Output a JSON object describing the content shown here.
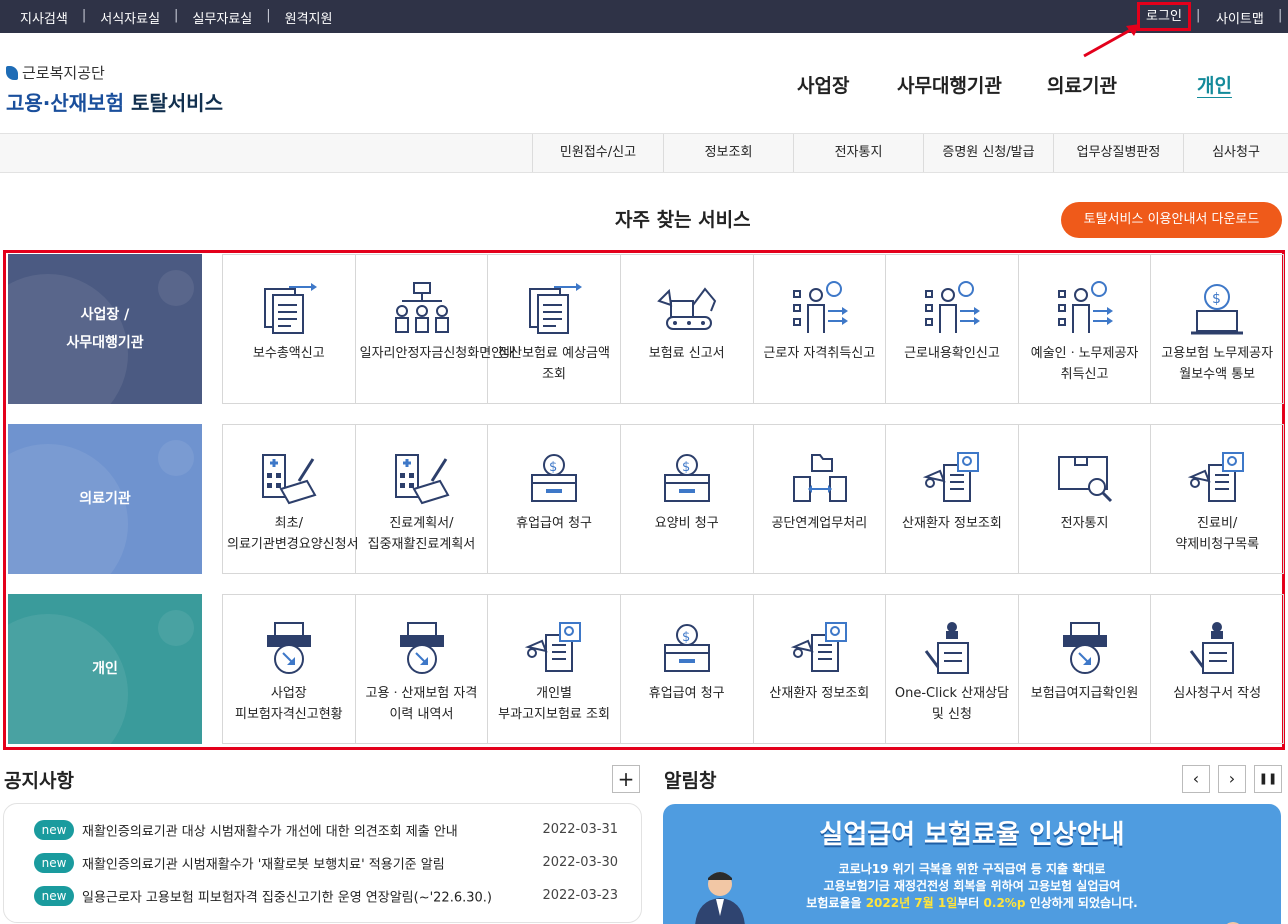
{
  "topbar": {
    "links": [
      "지사검색",
      "서식자료실",
      "실무자료실",
      "원격지원"
    ],
    "login": "로그인",
    "sitemap": "사이트맵",
    "separator": "|"
  },
  "logo": {
    "org": "근로복지공단",
    "service_blue": "고용·산재보험",
    "service_dark": "토탈서비스"
  },
  "mainnav": [
    "사업장",
    "사무대행기관",
    "의료기관",
    "개인"
  ],
  "subnav": [
    "민원접수/신고",
    "정보조회",
    "전자통지",
    "증명원 신청/발급",
    "업무상질병판정",
    "심사청구"
  ],
  "section_title": "자주 찾는 서비스",
  "guide_button": "토탈서비스 이용안내서 다운로드",
  "rows": [
    {
      "head_line1": "사업장 /",
      "head_line2": "사무대행기관",
      "color": "#4b5a82",
      "items": [
        {
          "label": "보수총액신고",
          "icon": "document-stack-icon"
        },
        {
          "label": "일자리안정자금신청화면안내",
          "icon": "org-chart-icon"
        },
        {
          "label": "정산보험료 예상금액 조회",
          "icon": "document-stack-icon"
        },
        {
          "label": "보험료 신고서",
          "icon": "excavator-icon"
        },
        {
          "label": "근로자 자격취득신고",
          "icon": "worker-checklist-icon"
        },
        {
          "label": "근로내용확인신고",
          "icon": "worker-checklist-icon"
        },
        {
          "label": "예술인ㆍ노무제공자 취득신고",
          "icon": "worker-checklist-icon"
        },
        {
          "label": "고용보험 노무제공자 월보수액 통보",
          "icon": "money-bag-laptop-icon"
        }
      ]
    },
    {
      "head_line1": "의료기관",
      "head_line2": "",
      "color": "#6f93cf",
      "items": [
        {
          "label": "최초/의료기관변경요양신청서",
          "icon": "hospital-form-icon"
        },
        {
          "label": "진료계획서/집중재활진료계획서",
          "icon": "hospital-form-icon"
        },
        {
          "label": "휴업급여 청구",
          "icon": "coin-box-icon"
        },
        {
          "label": "요양비 청구",
          "icon": "coin-box-icon"
        },
        {
          "label": "공단연계업무처리",
          "icon": "folder-exchange-icon"
        },
        {
          "label": "산재환자 정보조회",
          "icon": "search-document-icon"
        },
        {
          "label": "전자통지",
          "icon": "mail-search-icon"
        },
        {
          "label": "진료비/약제비청구목록",
          "icon": "search-document-icon"
        }
      ]
    },
    {
      "head_line1": "개인",
      "head_line2": "",
      "color": "#3a9b9b",
      "items": [
        {
          "label": "사업장 피보험자격신고현황",
          "icon": "printer-arrow-icon"
        },
        {
          "label": "고용ㆍ산재보험 자격 이력 내역서",
          "icon": "printer-arrow-icon"
        },
        {
          "label": "개인별 부과고지보험료 조회",
          "icon": "search-document-icon"
        },
        {
          "label": "휴업급여 청구",
          "icon": "coin-box-icon"
        },
        {
          "label": "산재환자 정보조회",
          "icon": "search-document-icon"
        },
        {
          "label": "One-Click 산재상담 및 신청",
          "icon": "stamp-document-icon"
        },
        {
          "label": "보험급여지급확인원",
          "icon": "printer-arrow-icon"
        },
        {
          "label": "심사청구서 작성",
          "icon": "stamp-document-icon"
        }
      ]
    }
  ],
  "notice": {
    "title": "공지사항",
    "more": "+",
    "badge": "new",
    "items": [
      {
        "title": "재활인증의료기관 대상 시범재활수가 개선에 대한 의견조회 제출 안내",
        "date": "2022-03-31"
      },
      {
        "title": "재활인증의료기관 시범재활수가 '재활로봇 보행치료' 적용기준 알림",
        "date": "2022-03-30"
      },
      {
        "title": "일용근로자 고용보험 피보험자격 집중신고기한 운영 연장알림(~'22.6.30.)",
        "date": "2022-03-23"
      }
    ]
  },
  "alarm": {
    "title": "알림창",
    "prev": "‹",
    "next": "›",
    "pause": "❚❚",
    "banner_title": "실업급여 보험료율 인상안내",
    "line1": "코로나19 위기 극복을 위한 구직급여 등 지출 확대로",
    "line2": "고용보험기금 재정건전성 회복을 위하여 고용보험 실업급여",
    "line3_pre": "보험료율을 ",
    "line3_hl1": "2022년 7월 1일",
    "line3_mid": "부터 ",
    "line3_hl2": "0.2%p",
    "line3_post": " 인상하게 되었습니다."
  },
  "colors": {
    "topbar": "#2f3347",
    "accent_teal": "#138a9a",
    "guide_orange": "#ef5a1a",
    "highlight_red": "#e3001b",
    "icon_navy": "#2d3f6b",
    "icon_blue": "#3e78c8"
  }
}
